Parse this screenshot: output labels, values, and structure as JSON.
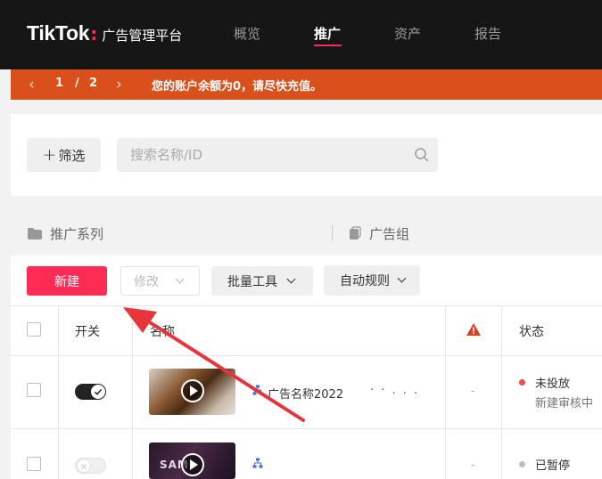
{
  "header": {
    "brand": "TikTok",
    "brand_colon": ":",
    "brand_subtitle": "广告管理平台",
    "tabs": [
      {
        "label": "概览",
        "active": false
      },
      {
        "label": "推广",
        "active": true
      },
      {
        "label": "资产",
        "active": false
      },
      {
        "label": "报告",
        "active": false
      }
    ]
  },
  "notice": {
    "page_current": "1",
    "page_separator": "/",
    "page_total": "2",
    "message": "您的账户余额为0，请尽快充值。",
    "background_color": "#d9501d"
  },
  "filter": {
    "filter_button_label": "筛选",
    "search_placeholder": "搜索名称/ID"
  },
  "tiers": {
    "campaign": "推广系列",
    "ad_group": "广告组"
  },
  "toolbar": {
    "new_label": "新建",
    "edit_label": "修改",
    "bulk_label": "批量工具",
    "auto_rules_label": "自动规则",
    "accent_color": "#fe2c55"
  },
  "table": {
    "columns": {
      "toggle": "开关",
      "name": "名称",
      "warning_icon": "warning-icon",
      "status": "状态"
    },
    "rows": [
      {
        "toggle_on": true,
        "name": "广告名称2022",
        "name_extra": "· ·  . . .",
        "metric": "-",
        "status": "未投放",
        "status_detail": "新建审核中",
        "status_color": "#f04a4a"
      },
      {
        "toggle_on": false,
        "thumb_text": "SAM",
        "name": "",
        "metric": "-",
        "status": "已暂停",
        "status_color": "#bdbdbd"
      }
    ]
  },
  "annotation": {
    "arrow_color": "#e8343c"
  }
}
